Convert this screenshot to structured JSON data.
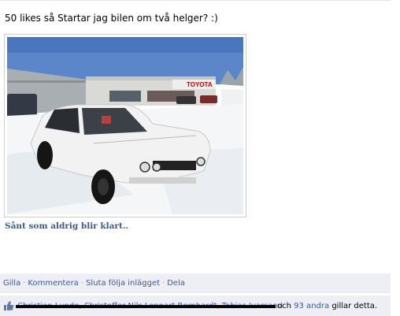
{
  "post": {
    "text": "50 likes så Startar jag bilen om två helger? :)",
    "caption": "Sånt som aldrig blir klart..",
    "dealer_sign": "TOYOTA"
  },
  "actions": {
    "like": "Gilla",
    "comment": "Kommentera",
    "unfollow": "Sluta följa inlägget",
    "share": "Dela",
    "separator": "·"
  },
  "likes": {
    "names": "Christian Lunde, Christoffer Nils Lennart Bernhardt, Tobias Ivarsand",
    "conjunction": "och",
    "others_link": "93 andra",
    "suffix": "gillar detta."
  },
  "colors": {
    "link": "#3b5998",
    "bar_bg": "#edeff4"
  }
}
